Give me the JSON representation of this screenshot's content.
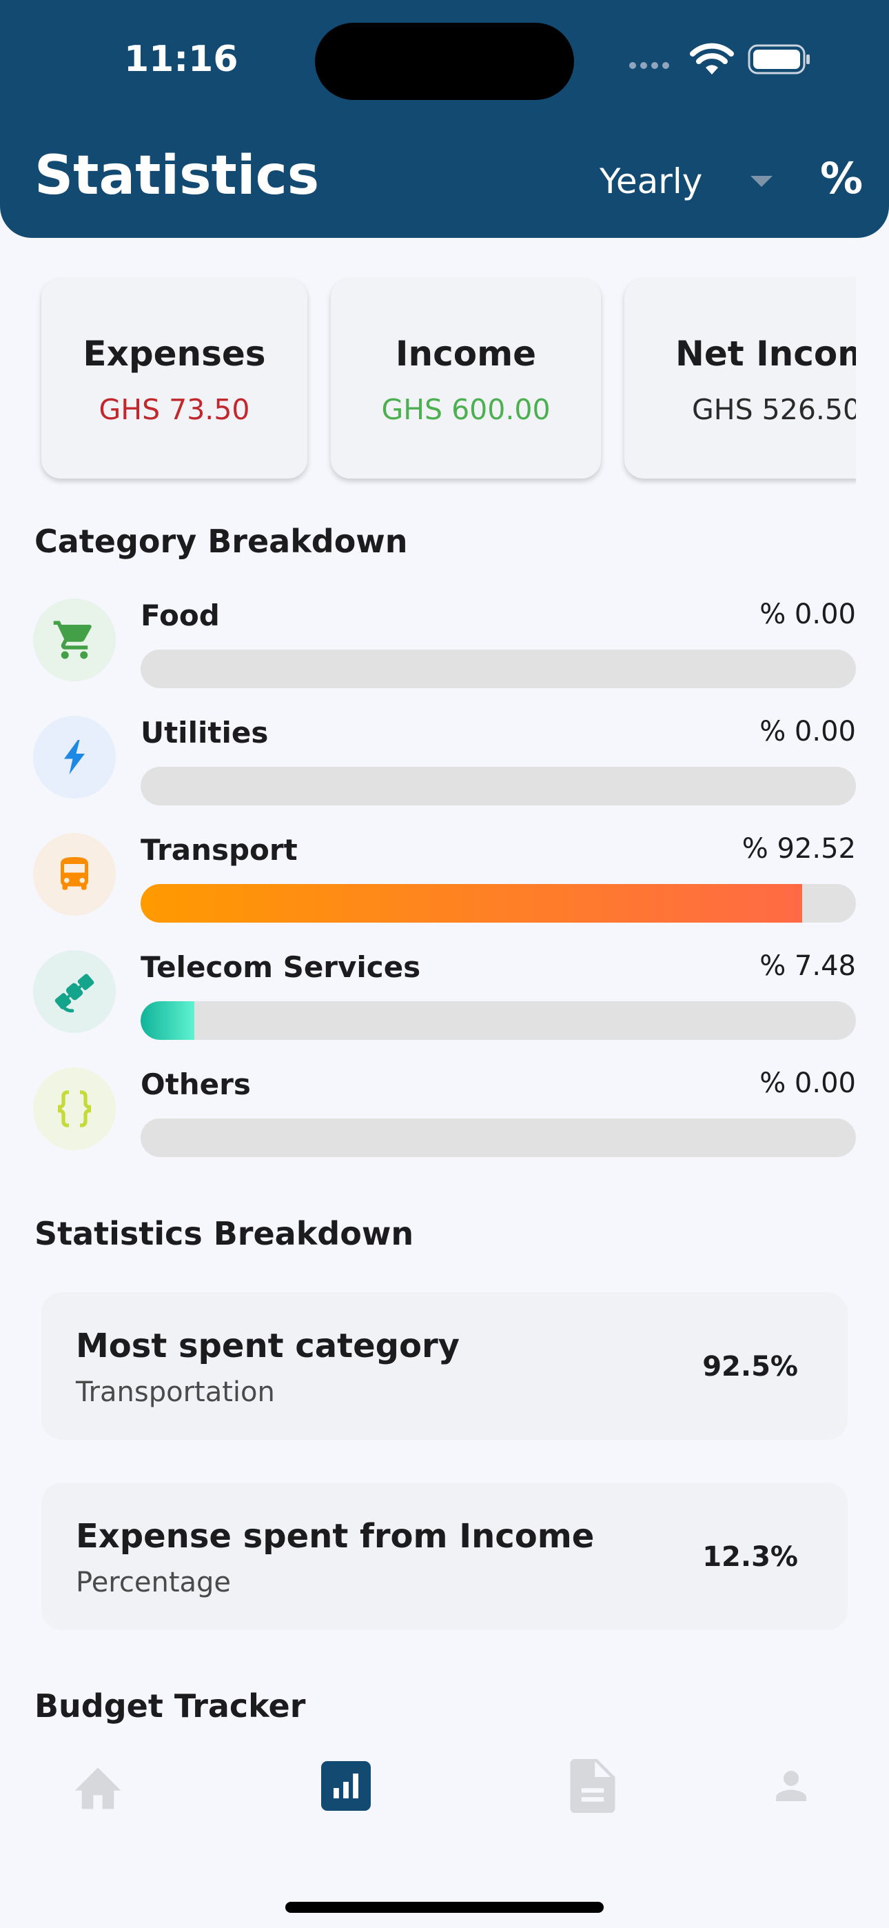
{
  "status_bar": {
    "time": "11:16"
  },
  "header": {
    "title": "Statistics",
    "period": "Yearly",
    "percent_toggle": "%",
    "background": "#134a72"
  },
  "summary_cards": [
    {
      "title": "Expenses",
      "value": "GHS 73.50",
      "color": "#c0282d"
    },
    {
      "title": "Income",
      "value": "GHS 600.00",
      "color": "#4caf50"
    },
    {
      "title": "Net Incom",
      "value": "GHS 526.50",
      "color": "#2a2a2a"
    }
  ],
  "category_breakdown": {
    "heading": "Category Breakdown",
    "items": [
      {
        "name": "Food",
        "percent_label": "% 0.00",
        "fill_fraction": 0.0,
        "icon": "cart-icon",
        "icon_color": "#43a047",
        "icon_bg": "#e8f3ea"
      },
      {
        "name": "Utilities",
        "percent_label": "% 0.00",
        "fill_fraction": 0.0,
        "icon": "bolt-icon",
        "icon_color": "#1e88e5",
        "icon_bg": "#e6effb"
      },
      {
        "name": "Transport",
        "percent_label": "% 92.52",
        "fill_fraction": 0.9252,
        "icon": "bus-icon",
        "icon_color": "#fb8c00",
        "icon_bg": "#f8eee4",
        "fill_from": "#ff9a00",
        "fill_to": "#ff6a45"
      },
      {
        "name": "Telecom Services",
        "percent_label": "% 7.48",
        "fill_fraction": 0.0748,
        "icon": "satellite-icon",
        "icon_color": "#14a38b",
        "icon_bg": "#e3f1ef",
        "fill_from": "#11b39a",
        "fill_to": "#5ef2d0"
      },
      {
        "name": "Others",
        "percent_label": "% 0.00",
        "fill_fraction": 0.0,
        "icon": "braces-icon",
        "icon_color": "#c6da3c",
        "icon_bg": "#f1f5e4"
      }
    ]
  },
  "statistics_breakdown": {
    "heading": "Statistics Breakdown",
    "items": [
      {
        "title": "Most spent category",
        "subtitle": "Transportation",
        "value": "92.5%"
      },
      {
        "title": "Expense spent from Income",
        "subtitle": "Percentage",
        "value": "12.3%"
      }
    ]
  },
  "budget_tracker": {
    "heading": "Budget Tracker"
  },
  "bottom_nav": {
    "items": [
      {
        "icon": "home-icon",
        "active": false
      },
      {
        "icon": "stats-icon",
        "active": true
      },
      {
        "icon": "document-icon",
        "active": false
      },
      {
        "icon": "profile-icon",
        "active": false
      }
    ],
    "active_color": "#134a72",
    "inactive_color": "#d6d8dc"
  }
}
